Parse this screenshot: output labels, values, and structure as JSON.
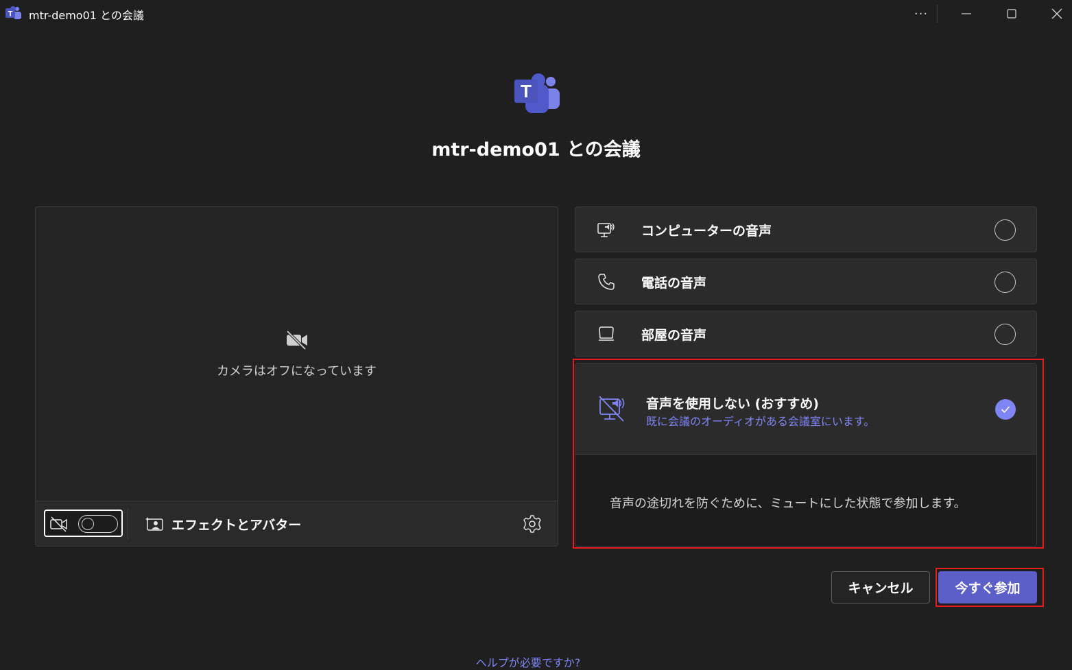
{
  "window": {
    "title": "mtr-demo01 との会議",
    "more_label": "···"
  },
  "meeting": {
    "title": "mtr-demo01 との会議"
  },
  "video": {
    "camera_off_text": "カメラはオフになっています",
    "effects_label": "エフェクトとアバター",
    "camera_on": false
  },
  "audio_options": [
    {
      "label": "コンピューターの音声",
      "icon": "computer-speaker-icon",
      "selected": false
    },
    {
      "label": "電話の音声",
      "icon": "phone-icon",
      "selected": false
    },
    {
      "label": "部屋の音声",
      "icon": "room-device-icon",
      "selected": false
    }
  ],
  "selected_option": {
    "title": "音声を使用しない (おすすめ)",
    "subtitle": "既に会議のオーディオがある会議室にいます。",
    "note": "音声の途切れを防ぐために、ミュートにした状態で参加します。",
    "icon": "no-audio-icon",
    "selected": true
  },
  "actions": {
    "cancel_label": "キャンセル",
    "join_label": "今すぐ参加"
  },
  "help": {
    "label": "ヘルプが必要ですか?"
  },
  "colors": {
    "background": "#1f1f1f",
    "panel": "#2b2b2b",
    "accent": "#5b5fc7",
    "accent_light": "#7f85f5",
    "highlight": "#e81e1e"
  }
}
